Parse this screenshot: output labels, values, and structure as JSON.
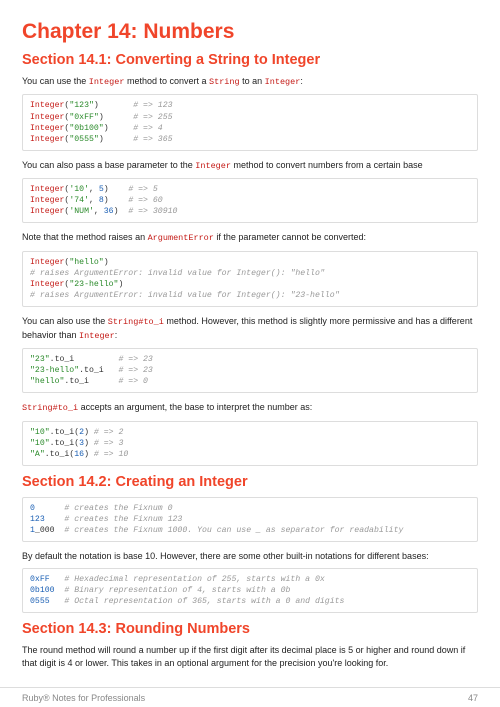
{
  "chapter_title": "Chapter 14: Numbers",
  "section1": {
    "title": "Section 14.1: Converting a String to Integer",
    "p1_a": "You can use the ",
    "p1_b": "Integer",
    "p1_c": " method to convert a ",
    "p1_d": "String",
    "p1_e": " to an ",
    "p1_f": "Integer",
    "p1_g": ":",
    "code1": {
      "l1_a": "Integer",
      "l1_b": "(",
      "l1_c": "\"123\"",
      "l1_d": ")       ",
      "l1_e": "# => 123",
      "l2_a": "Integer",
      "l2_b": "(",
      "l2_c": "\"0xFF\"",
      "l2_d": ")      ",
      "l2_e": "# => 255",
      "l3_a": "Integer",
      "l3_b": "(",
      "l3_c": "\"0b100\"",
      "l3_d": ")     ",
      "l3_e": "# => 4",
      "l4_a": "Integer",
      "l4_b": "(",
      "l4_c": "\"0555\"",
      "l4_d": ")      ",
      "l4_e": "# => 365"
    },
    "p2_a": "You can also pass a base parameter to the ",
    "p2_b": "Integer",
    "p2_c": " method to convert numbers from a certain base",
    "code2": {
      "l1_a": "Integer",
      "l1_b": "(",
      "l1_c": "'10'",
      "l1_d": ", ",
      "l1_e": "5",
      "l1_f": ")    ",
      "l1_g": "# => 5",
      "l2_a": "Integer",
      "l2_b": "(",
      "l2_c": "'74'",
      "l2_d": ", ",
      "l2_e": "8",
      "l2_f": ")    ",
      "l2_g": "# => 60",
      "l3_a": "Integer",
      "l3_b": "(",
      "l3_c": "'NUM'",
      "l3_d": ", ",
      "l3_e": "36",
      "l3_f": ")  ",
      "l3_g": "# => 30910"
    },
    "p3_a": "Note that the method raises an ",
    "p3_b": "ArgumentError",
    "p3_c": " if the parameter cannot be converted:",
    "code3": {
      "l1_a": "Integer",
      "l1_b": "(",
      "l1_c": "\"hello\"",
      "l1_d": ")",
      "l2": "# raises ArgumentError: invalid value for Integer(): \"hello\"",
      "l3_a": "Integer",
      "l3_b": "(",
      "l3_c": "\"23-hello\"",
      "l3_d": ")",
      "l4": "# raises ArgumentError: invalid value for Integer(): \"23-hello\""
    },
    "p4_a": "You can also use the ",
    "p4_b": "String#to_i",
    "p4_c": " method. However, this method is slightly more permissive and has a different behavior than ",
    "p4_d": "Integer",
    "p4_e": ":",
    "code4": {
      "l1_a": "\"23\"",
      "l1_b": ".to_i         ",
      "l1_c": "# => 23",
      "l2_a": "\"23-hello\"",
      "l2_b": ".to_i   ",
      "l2_c": "# => 23",
      "l3_a": "\"hello\"",
      "l3_b": ".to_i      ",
      "l3_c": "# => 0"
    },
    "p5_a": "String#to_i",
    "p5_b": " accepts an argument, the base to interpret the number as:",
    "code5": {
      "l1_a": "\"10\"",
      "l1_b": ".to_i(",
      "l1_c": "2",
      "l1_d": ") ",
      "l1_e": "# => 2",
      "l2_a": "\"10\"",
      "l2_b": ".to_i(",
      "l2_c": "3",
      "l2_d": ") ",
      "l2_e": "# => 3",
      "l3_a": "\"A\"",
      "l3_b": ".to_i(",
      "l3_c": "16",
      "l3_d": ") ",
      "l3_e": "# => 10"
    }
  },
  "section2": {
    "title": "Section 14.2: Creating an Integer",
    "code1": {
      "l1_a": "0",
      "l1_b": "      ",
      "l1_c": "# creates the Fixnum 0",
      "l2_a": "123",
      "l2_b": "    ",
      "l2_c": "# creates the Fixnum 123",
      "l3_a": "1",
      "l3_b": "_000",
      "l3_c": "  ",
      "l3_d": "# creates the Fixnum 1000. You can use _ as separator for readability"
    },
    "p1": "By default the notation is base 10. However, there are some other built-in notations for different bases:",
    "code2": {
      "l1_a": "0xFF",
      "l1_b": "   ",
      "l1_c": "# Hexadecimal representation of 255, starts with a 0x",
      "l2_a": "0b100",
      "l2_b": "  ",
      "l2_c": "# Binary representation of 4, starts with a 0b",
      "l3_a": "0555",
      "l3_b": "   ",
      "l3_c": "# Octal representation of 365, starts with a 0 and digits"
    }
  },
  "section3": {
    "title": "Section 14.3: Rounding Numbers",
    "p1": "The round method will round a number up if the first digit after its decimal place is 5 or higher and round down if that digit is 4 or lower. This takes in an optional argument for the precision you're looking for."
  },
  "footer": {
    "left": "Ruby® Notes for Professionals",
    "right": "47"
  }
}
